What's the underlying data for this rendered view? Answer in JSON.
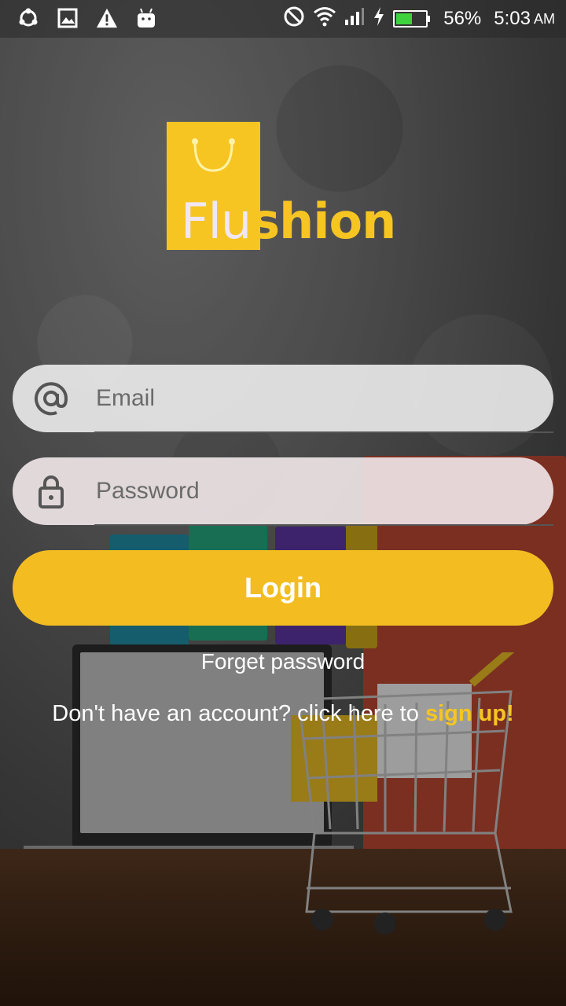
{
  "status_bar": {
    "battery_percent": "56%",
    "battery_level": 0.56,
    "time": "5:03",
    "ampm": "AM",
    "icons_left": [
      "sync-icon",
      "gallery-icon",
      "warning-icon",
      "android-icon"
    ],
    "icons_right": [
      "do-not-disturb-icon",
      "wifi-icon",
      "signal-icon",
      "charging-icon",
      "battery-icon"
    ]
  },
  "logo": {
    "text_part1": "Flu",
    "text_part2": "shion",
    "brand_color": "#f6c522"
  },
  "login_form": {
    "email": {
      "placeholder": "Email",
      "value": "",
      "icon": "at-icon"
    },
    "password": {
      "placeholder": "Password",
      "value": "",
      "icon": "lock-icon"
    },
    "login_label": "Login",
    "forget_label": "Forget password",
    "signup_prefix": "Don't have an account? click here to ",
    "signup_link": "sign up!"
  },
  "colors": {
    "accent": "#f3bd21",
    "field_bg": "#f0f0f0",
    "text_light": "#ffffff"
  }
}
